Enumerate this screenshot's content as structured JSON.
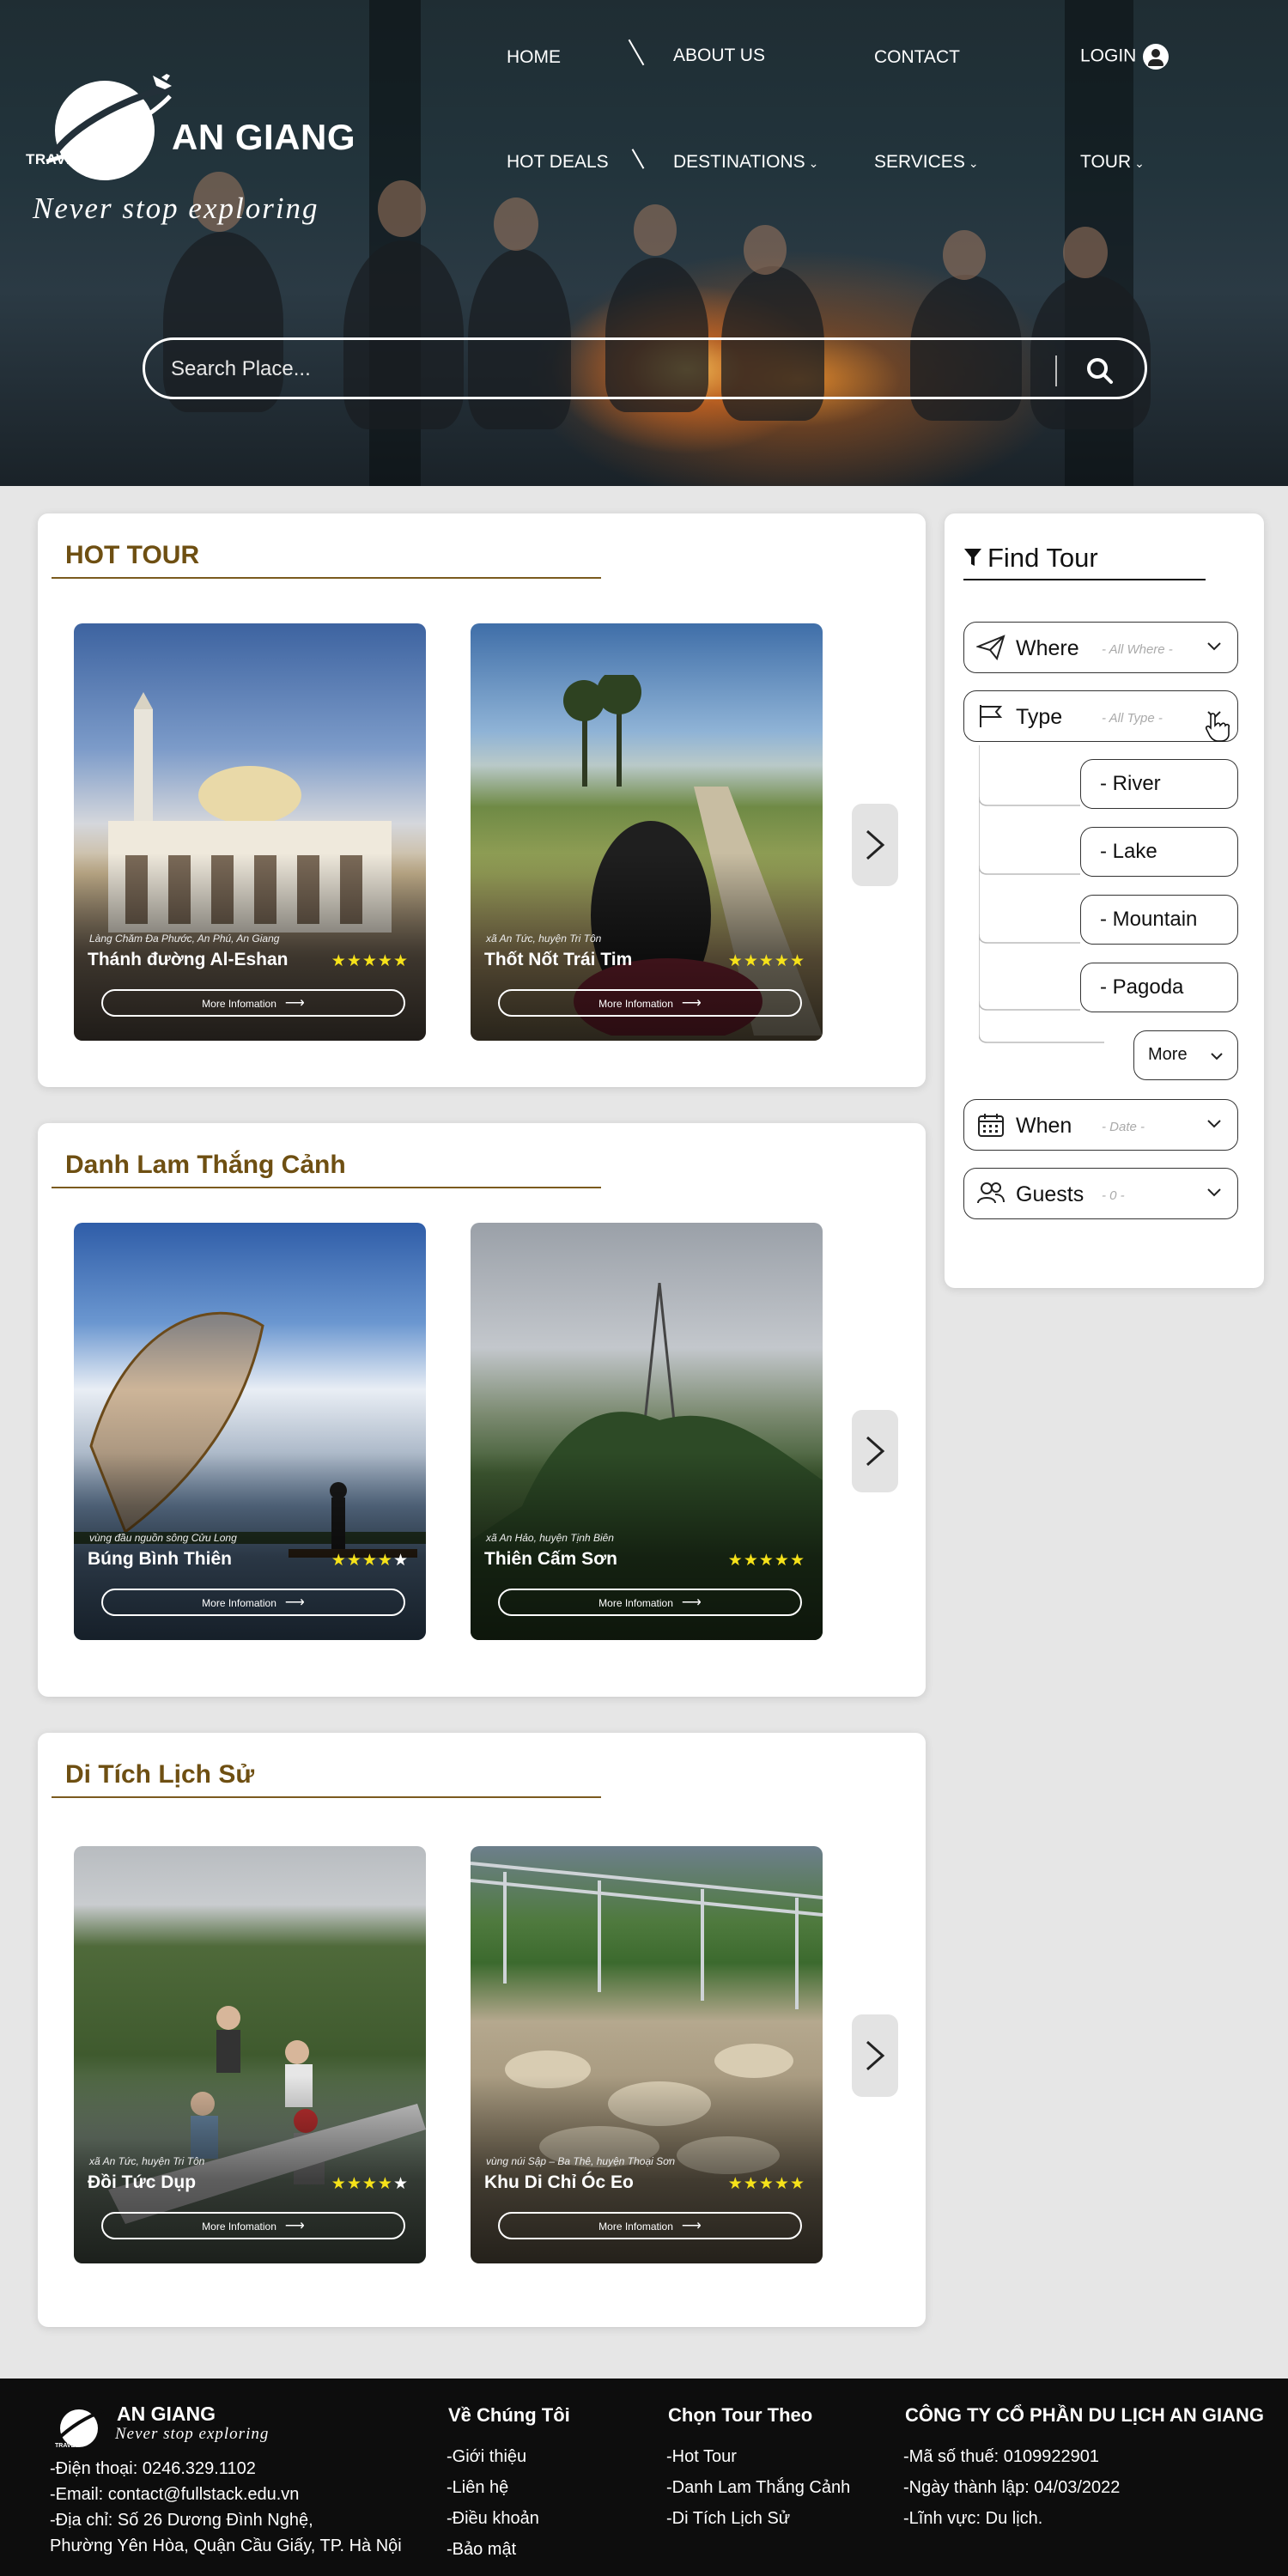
{
  "header": {
    "logo": {
      "travel": "TRAVEL",
      "brand": "AN GIANG",
      "slogan": "Never stop exploring"
    },
    "nav_top": {
      "home": "HOME",
      "about": "ABOUT US",
      "contact": "CONTACT",
      "login": "LOGIN"
    },
    "nav_bottom": {
      "hot_deals": "HOT DEALS",
      "destinations": "DESTINATIONS",
      "services": "SERVICES",
      "tour": "TOUR"
    },
    "search": {
      "placeholder": "Search Place..."
    }
  },
  "sections": [
    {
      "title": "HOT TOUR",
      "cards": [
        {
          "location": "Làng Chăm Đa Phước, An Phú, An Giang",
          "name": "Thánh đường Al-Eshan",
          "rating": 5,
          "button": "More Infomation"
        },
        {
          "location": "xã An Tức, huyện Tri Tôn",
          "name": "Thốt Nốt Trái Tim",
          "rating": 5,
          "button": "More Infomation"
        }
      ]
    },
    {
      "title": "Danh Lam Thắng Cảnh",
      "cards": [
        {
          "location": "vùng đầu nguồn sông Cửu Long",
          "name": "Búng Bình Thiên",
          "rating": 4,
          "button": "More Infomation"
        },
        {
          "location": "xã An Hảo, huyện Tịnh Biên",
          "name": "Thiên Cấm Sơn",
          "rating": 5,
          "button": "More Infomation"
        }
      ]
    },
    {
      "title": "Di Tích Lịch Sử",
      "cards": [
        {
          "location": "xã An Tức, huyện Tri Tôn",
          "name": "Đồi Tức Dụp",
          "rating": 4,
          "button": "More Infomation"
        },
        {
          "location": "vùng núi Sập – Ba Thê, huyện Thoại Sơn",
          "name": "Khu Di Chỉ Óc Eo",
          "rating": 5,
          "button": "More Infomation"
        }
      ]
    }
  ],
  "finder": {
    "title": "Find Tour",
    "where": {
      "label": "Where",
      "placeholder": "- All Where -"
    },
    "type": {
      "label": "Type",
      "placeholder": "- All Type -",
      "options": [
        "- River",
        "- Lake",
        "- Mountain",
        "- Pagoda"
      ],
      "more": "More"
    },
    "when": {
      "label": "When",
      "placeholder": "- Date -"
    },
    "guests": {
      "label": "Guests",
      "placeholder": "- 0 -"
    }
  },
  "footer": {
    "brand": "AN GIANG",
    "slogan": "Never stop exploring",
    "contact": [
      "-Điện thoại: 0246.329.1102",
      "-Email: contact@fullstack.edu.vn",
      "-Địa chỉ: Số 26 Dương Đình Nghệ,",
      "Phường Yên Hòa, Quận Cầu Giấy, TP. Hà Nội"
    ],
    "about": {
      "title": "Về Chúng Tôi",
      "items": [
        "-Giới thiệu",
        "-Liên hệ",
        "-Điều khoản",
        "-Bảo mật"
      ]
    },
    "choose": {
      "title": "Chọn Tour Theo",
      "items": [
        "-Hot Tour",
        "-Danh Lam Thắng Cảnh",
        "-Di Tích Lịch Sử"
      ]
    },
    "company": {
      "title": "CÔNG TY CỔ PHẦN DU LỊCH AN GIANG",
      "items": [
        "-Mã số thuế: 0109922901",
        "-Ngày thành lập: 04/03/2022",
        "-Lĩnh vực: Du lịch."
      ]
    }
  },
  "colors": {
    "accent_title": "#6e4f12",
    "star": "#f6e21a",
    "footer_bg": "#0d0d0d"
  }
}
